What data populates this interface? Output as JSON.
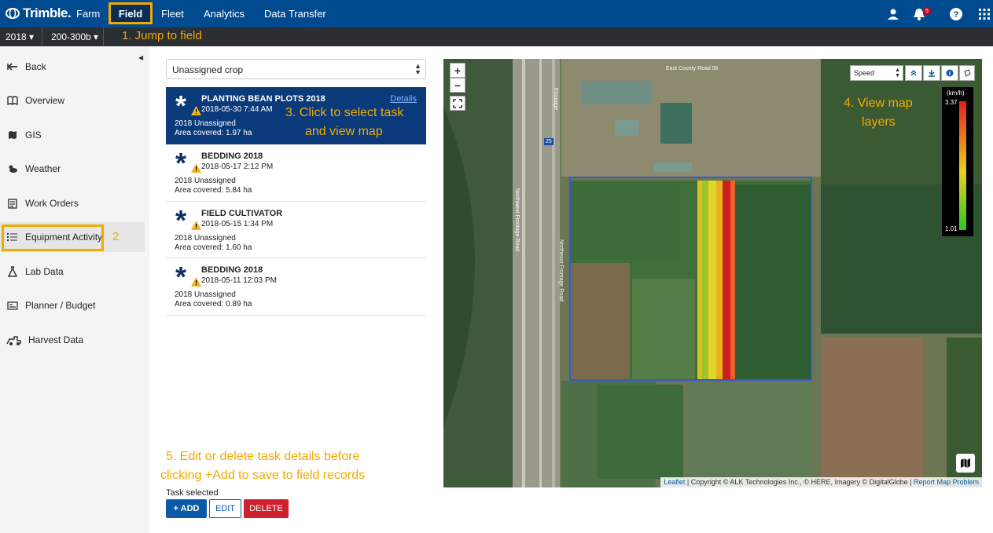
{
  "brand": {
    "logo_text": "Trimble."
  },
  "nav": {
    "items": [
      "Farm",
      "Field",
      "Fleet",
      "Analytics",
      "Data Transfer"
    ],
    "notification_count": "5"
  },
  "subbar": {
    "year": "2018",
    "field": "200-300b"
  },
  "annotations": {
    "jump": "1. Jump to field",
    "step2": "2",
    "select_task_line1": "3. Click to select task",
    "select_task_line2": "and view map",
    "map_layers_line1": "4. View map",
    "map_layers_line2": "layers",
    "edit_line1": "5. Edit or delete task details before",
    "edit_line2": "clicking +Add to save to field records"
  },
  "sidebar": {
    "items": [
      {
        "label": "Back",
        "icon": "back-arrow-icon"
      },
      {
        "label": "Overview",
        "icon": "book-icon"
      },
      {
        "label": "GIS",
        "icon": "map-icon"
      },
      {
        "label": "Weather",
        "icon": "weather-icon"
      },
      {
        "label": "Work Orders",
        "icon": "clipboard-icon"
      },
      {
        "label": "Equipment Activity",
        "icon": "list-icon"
      },
      {
        "label": "Lab Data",
        "icon": "flask-icon"
      },
      {
        "label": "Planner / Budget",
        "icon": "planner-icon"
      },
      {
        "label": "Harvest Data",
        "icon": "harvester-icon"
      }
    ]
  },
  "crop_select": {
    "value": "Unassigned crop"
  },
  "tasks": [
    {
      "name": "PLANTING BEAN PLOTS 2018",
      "date": "2018-05-30 7:44 AM",
      "line1": "2018 Unassigned",
      "line2": "Area covered: 1.97 ha",
      "selected": true,
      "details": "Details"
    },
    {
      "name": "BEDDING 2018",
      "date": "2018-05-17 2:12 PM",
      "line1": "2018 Unassigned",
      "line2": "Area covered: 5.84 ha"
    },
    {
      "name": "FIELD CULTIVATOR",
      "date": "2018-05-15 1:34 PM",
      "line1": "2018 Unassigned",
      "line2": "Area covered: 1.60 ha"
    },
    {
      "name": "BEDDING 2018",
      "date": "2018-05-11 12:03 PM",
      "line1": "2018 Unassigned",
      "line2": "Area covered: 0.89 ha"
    }
  ],
  "bottom": {
    "task_selected": "Task selected",
    "add": "+ ADD",
    "edit": "EDIT",
    "delete": "DELETE"
  },
  "map": {
    "zoom_in": "+",
    "zoom_out": "−",
    "layer_select": "Speed",
    "legend": {
      "unit": "(km/h)",
      "max": "3.37",
      "min": "1.01"
    },
    "road_labels": {
      "county": "East County Road 56",
      "frontage": "Frontage",
      "nw_frontage": "Northwest Frontage Road",
      "ne_frontage": "Northeast Frontage Road",
      "interstate": "25"
    },
    "attribution": {
      "leaflet": "Leaflet",
      "copyright": " | Copyright © ALK Technologies Inc., © HERE, Imagery © DigitalGlobe | ",
      "report": "Report Map Problem"
    }
  },
  "colors": {
    "nav_bg": "#004a8f",
    "highlight": "#f2a900",
    "selected_task": "#0b3a7a",
    "delete": "#d0202e"
  }
}
